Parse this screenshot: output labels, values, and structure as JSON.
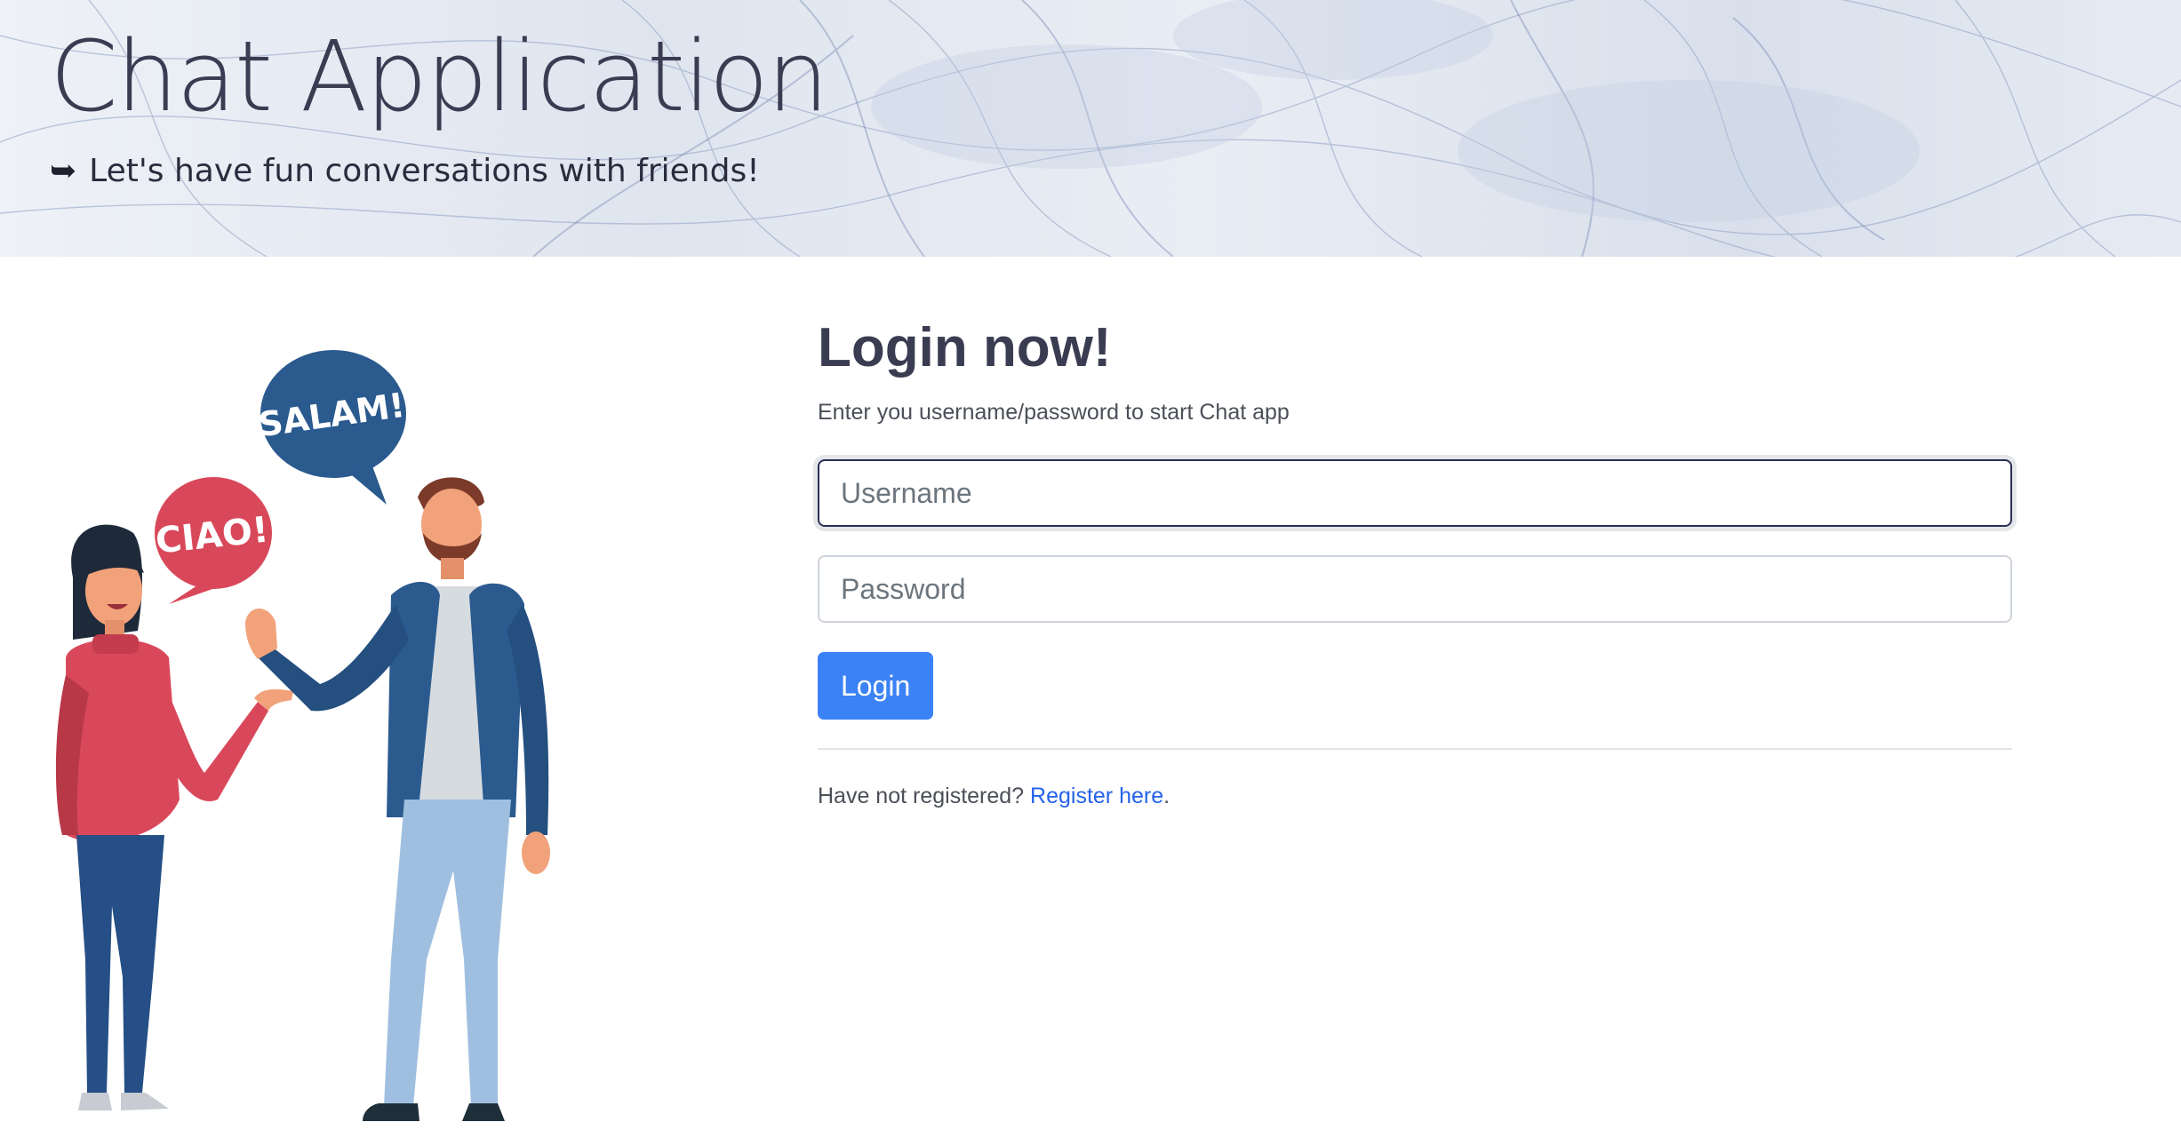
{
  "header": {
    "title": "Chat Application",
    "tagline_arrow": "➥",
    "tagline": "Let's have fun conversations with friends!"
  },
  "illustration": {
    "bubble_left": "CIAO!",
    "bubble_right": "SALAM!"
  },
  "login": {
    "heading": "Login now!",
    "subtitle": "Enter you username/password to start Chat app",
    "username_placeholder": "Username",
    "password_placeholder": "Password",
    "button_label": "Login",
    "register_prefix": "Have not registered? ",
    "register_link": "Register here",
    "register_suffix": "."
  },
  "colors": {
    "accent": "#3b82f6",
    "link": "#2563eb",
    "heading": "#3a3c52",
    "bubble_red": "#d9485a",
    "bubble_blue": "#2b5a8f"
  }
}
